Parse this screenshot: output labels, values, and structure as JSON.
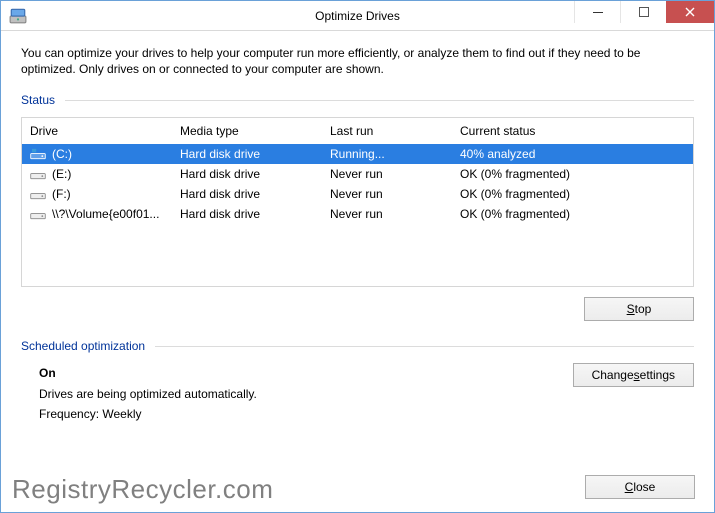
{
  "window": {
    "title": "Optimize Drives"
  },
  "description": "You can optimize your drives to help your computer run more efficiently, or analyze them to find out if they need to be optimized. Only drives on or connected to your computer are shown.",
  "status_label": "Status",
  "columns": {
    "drive": "Drive",
    "media": "Media type",
    "last": "Last run",
    "status": "Current status"
  },
  "drives": [
    {
      "name": "(C:)",
      "media": "Hard disk drive",
      "last": "Running...",
      "status": "40% analyzed",
      "selected": true,
      "system": true
    },
    {
      "name": "(E:)",
      "media": "Hard disk drive",
      "last": "Never run",
      "status": "OK (0% fragmented)",
      "selected": false,
      "system": false
    },
    {
      "name": "(F:)",
      "media": "Hard disk drive",
      "last": "Never run",
      "status": "OK (0% fragmented)",
      "selected": false,
      "system": false
    },
    {
      "name": "\\\\?\\Volume{e00f01...",
      "media": "Hard disk drive",
      "last": "Never run",
      "status": "OK (0% fragmented)",
      "selected": false,
      "system": false
    }
  ],
  "buttons": {
    "stop": "Stop",
    "change": "Change settings",
    "close": "Close"
  },
  "access": {
    "stop": "S",
    "change_pre": "Change ",
    "change_u": "s",
    "change_post": "ettings",
    "close_u": "C",
    "close_post": "lose"
  },
  "scheduled": {
    "label": "Scheduled optimization",
    "state": "On",
    "desc": "Drives are being optimized automatically.",
    "freq": "Frequency: Weekly"
  },
  "watermark": "RegistryRecycler.com"
}
